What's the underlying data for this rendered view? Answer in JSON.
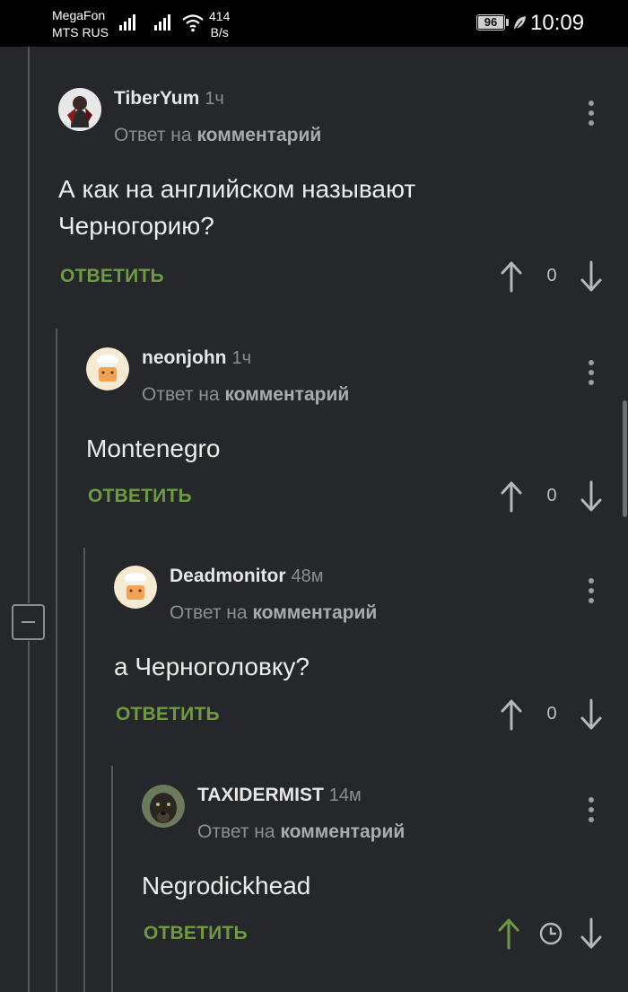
{
  "status_bar": {
    "carrier_1": "MegaFon",
    "carrier_2": "MTS RUS",
    "net_speed_value": "414",
    "net_speed_unit": "B/s",
    "battery": "96",
    "time": "10:09"
  },
  "reply_to_prefix": "Ответ на",
  "reply_to_target": "комментарий",
  "reply_label": "ОТВЕТИТЬ",
  "comments": [
    {
      "author": "TiberYum",
      "time": "1ч",
      "text_line_1": "А как на английском называют",
      "text_line_2": "Черногорию?",
      "rating": "0"
    },
    {
      "author": "neonjohn",
      "time": "1ч",
      "text_line_1": "Montenegro",
      "rating": "0"
    },
    {
      "author": "Deadmonitor",
      "time": "48м",
      "text_line_1": "а Черноголовку?",
      "rating": "0"
    },
    {
      "author": "TAXIDERMIST",
      "time": "14м",
      "text_line_1": "Negrodickhead",
      "rating_icon": "clock-icon"
    }
  ],
  "colors": {
    "background": "#25272a",
    "accent_green": "#6f9a44",
    "muted_text": "#8b8e92"
  }
}
